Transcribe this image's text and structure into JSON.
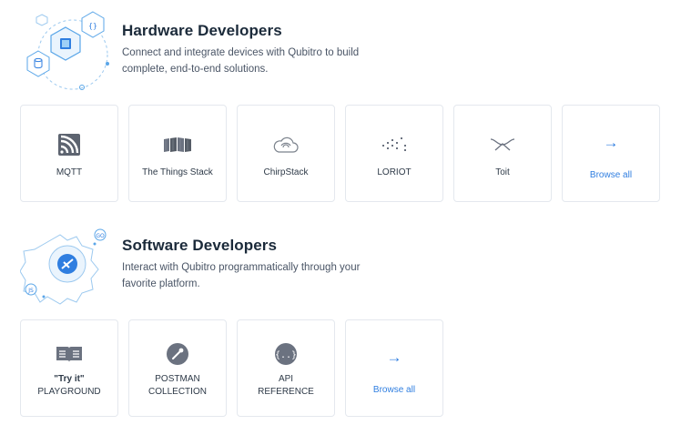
{
  "hardware": {
    "title": "Hardware Developers",
    "description": "Connect and integrate devices with Qubitro to build complete, end-to-end solutions.",
    "cards": [
      {
        "label": "MQTT",
        "icon": "mqtt-icon"
      },
      {
        "label": "The Things Stack",
        "icon": "things-stack-icon"
      },
      {
        "label": "ChirpStack",
        "icon": "chirpstack-icon"
      },
      {
        "label": "LORIOT",
        "icon": "loriot-icon"
      },
      {
        "label": "Toit",
        "icon": "toit-icon"
      }
    ],
    "browse_all": "Browse all"
  },
  "software": {
    "title": "Software Developers",
    "description": "Interact with Qubitro programmatically through your favorite platform.",
    "cards": [
      {
        "line1": "\"Try it\"",
        "line2": "PLAYGROUND",
        "icon": "book-icon"
      },
      {
        "line1": "POSTMAN",
        "line2": "COLLECTION",
        "icon": "postman-icon"
      },
      {
        "line1": "API",
        "line2": "REFERENCE",
        "icon": "api-braces-icon"
      }
    ],
    "browse_all": "Browse all"
  },
  "colors": {
    "accent": "#2f7ee0",
    "illustration": "#5aa6e8",
    "icon_gray": "#6b7280"
  },
  "arrow_glyph": "→"
}
